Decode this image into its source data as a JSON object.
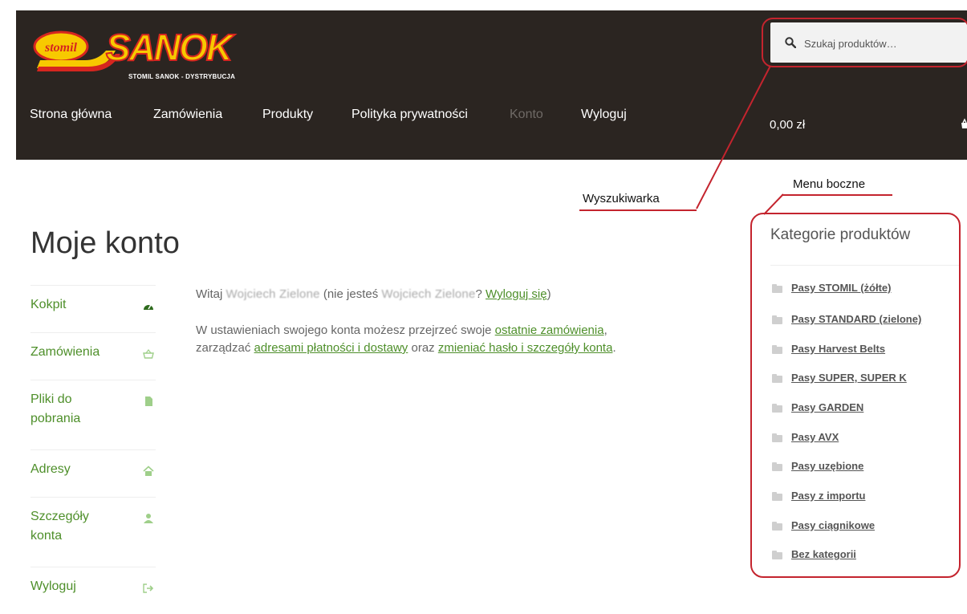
{
  "header": {
    "logo": {
      "brand_left": "stomil",
      "brand_right": "SANOK",
      "tagline": "STOMIL SANOK - DYSTRYBUCJA"
    },
    "search": {
      "placeholder": "Szukaj produktów…"
    },
    "nav": [
      {
        "label": "Strona główna",
        "active": false
      },
      {
        "label": "Zamówienia",
        "active": false
      },
      {
        "label": "Produkty",
        "active": false
      },
      {
        "label": "Polityka prywatności",
        "active": false
      },
      {
        "label": "Konto",
        "active": true
      },
      {
        "label": "Wyloguj",
        "active": false
      }
    ],
    "cart_total": "0,00 zł"
  },
  "annotations": {
    "search_label": "Wyszukiwarka",
    "sidebar_label": "Menu boczne",
    "color": "#c4242e"
  },
  "main": {
    "title": "Moje konto",
    "account_nav": [
      {
        "label": "Kokpit",
        "icon": "dashboard-icon"
      },
      {
        "label": "Zamówienia",
        "icon": "basket-icon"
      },
      {
        "label": "Pliki do pobrania",
        "icon": "file-icon"
      },
      {
        "label": "Adresy",
        "icon": "home-icon"
      },
      {
        "label": "Szczegóły konta",
        "icon": "user-icon"
      },
      {
        "label": "Wyloguj",
        "icon": "sign-out-icon"
      }
    ],
    "welcome": {
      "prefix": "Witaj",
      "name_blurred": "Wojciech Zielone",
      "middle": " (nie jesteś ",
      "name_blurred_2": "Wojciech Zielone",
      "question": "? ",
      "logout_link": "Wyloguj się",
      "suffix": ")"
    },
    "intro": {
      "text1": "W ustawieniach swojego konta możesz przejrzeć swoje ",
      "link_orders": "ostatnie zamówienia",
      "text2": ",",
      "text3": "zarządzać ",
      "link_addresses": "adresami płatności i dostawy",
      "text4": " oraz ",
      "link_account": "zmieniać hasło i szczegóły konta",
      "text5": "."
    }
  },
  "sidebar": {
    "title": "Kategorie produktów",
    "categories": [
      "Pasy STOMIL (żółte)",
      "Pasy STANDARD (zielone)",
      "Pasy Harvest Belts",
      "Pasy SUPER, SUPER K",
      "Pasy GARDEN",
      "Pasy AVX",
      "Pasy uzębione",
      "Pasy z importu",
      "Pasy ciągnikowe",
      "Bez kategorii"
    ]
  },
  "colors": {
    "header_bg": "#2b2521",
    "link_green": "#4e8f2a",
    "logo_yellow": "#f7c900",
    "logo_red": "#d6261f"
  }
}
